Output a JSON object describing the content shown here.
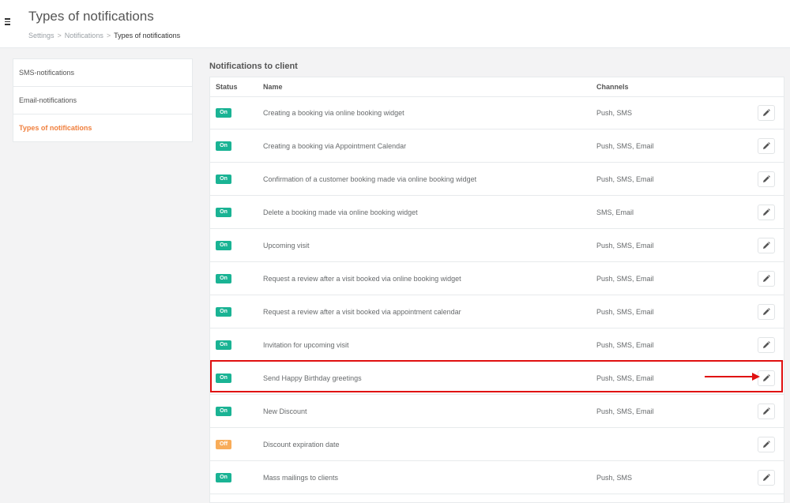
{
  "header": {
    "title": "Types of notifications",
    "breadcrumb": [
      "Settings",
      "Notifications",
      "Types of notifications"
    ],
    "separator": ">"
  },
  "sidebar": {
    "items": [
      {
        "label": "SMS-notifications",
        "active": false
      },
      {
        "label": "Email-notifications",
        "active": false
      },
      {
        "label": "Types of notifications",
        "active": true
      }
    ]
  },
  "main": {
    "section_title": "Notifications to client",
    "columns": [
      "Status",
      "Name",
      "Channels"
    ],
    "rows": [
      {
        "status": "On",
        "name": "Creating a booking via online booking widget",
        "channels": "Push, SMS"
      },
      {
        "status": "On",
        "name": "Creating a booking via Appointment Calendar",
        "channels": "Push, SMS, Email"
      },
      {
        "status": "On",
        "name": "Confirmation of a customer booking made via online booking widget",
        "channels": "Push, SMS, Email"
      },
      {
        "status": "On",
        "name": "Delete a booking made via online booking widget",
        "channels": "SMS, Email"
      },
      {
        "status": "On",
        "name": "Upcoming visit",
        "channels": "Push, SMS, Email"
      },
      {
        "status": "On",
        "name": "Request a review after a visit booked via online booking widget",
        "channels": "Push, SMS, Email"
      },
      {
        "status": "On",
        "name": "Request a review after a visit booked via appointment calendar",
        "channels": "Push, SMS, Email"
      },
      {
        "status": "On",
        "name": "Invitation for upcoming visit",
        "channels": "Push, SMS, Email"
      },
      {
        "status": "On",
        "name": "Send Happy Birthday greetings",
        "channels": "Push, SMS, Email"
      },
      {
        "status": "On",
        "name": "New Discount",
        "channels": "Push, SMS, Email"
      },
      {
        "status": "Off",
        "name": "Discount expiration date",
        "channels": ""
      },
      {
        "status": "On",
        "name": "Mass mailings to clients",
        "channels": "Push, SMS"
      }
    ],
    "highlighted_row_index": 8
  },
  "icons": {
    "menu": "hamburger-menu-icon",
    "edit": "pencil-icon",
    "annotation": "red-arrow-icon"
  },
  "colors": {
    "accent": "#f07f3c",
    "status_on": "#1ab394",
    "status_off": "#f8ac59",
    "highlight": "#e01010"
  }
}
